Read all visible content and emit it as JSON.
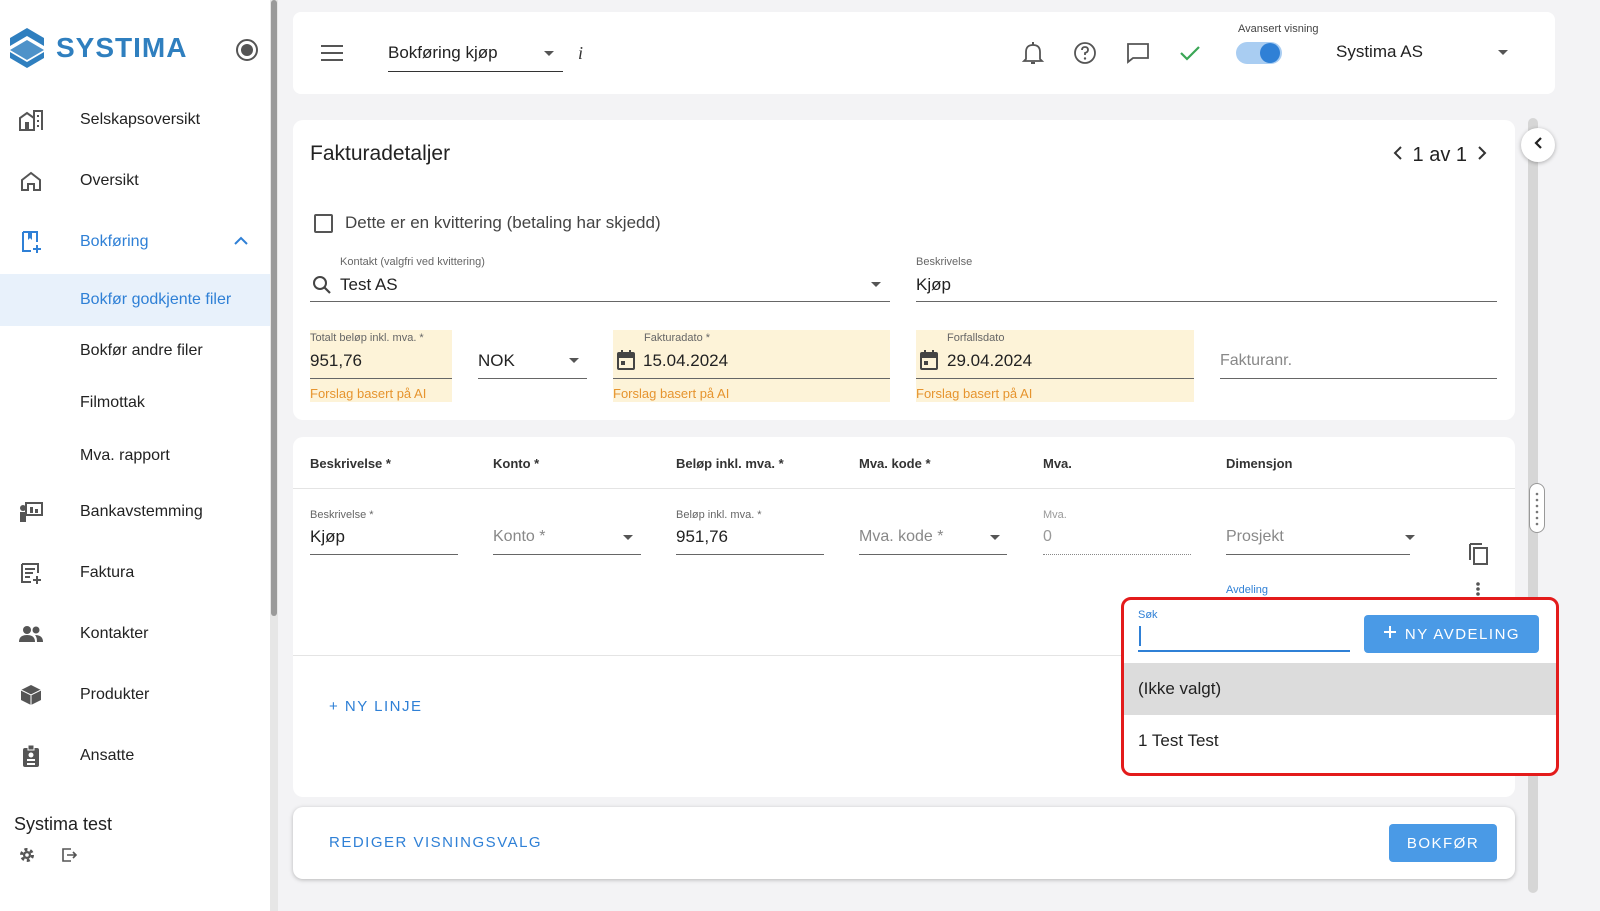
{
  "sidebar": {
    "logo_text": "SYSTIMA",
    "items": [
      {
        "label": "Selskapsoversikt",
        "icon": "company-overview-icon"
      },
      {
        "label": "Oversikt",
        "icon": "home-icon"
      },
      {
        "label": "Bokføring",
        "icon": "bookkeeping-icon"
      },
      {
        "label": "Bokfør godkjente filer"
      },
      {
        "label": "Bokfør andre filer"
      },
      {
        "label": "Filmottak"
      },
      {
        "label": "Mva. rapport"
      },
      {
        "label": "Bankavstemming",
        "icon": "bank-reconciliation-icon"
      },
      {
        "label": "Faktura",
        "icon": "invoice-icon"
      },
      {
        "label": "Kontakter",
        "icon": "contacts-icon"
      },
      {
        "label": "Produkter",
        "icon": "products-icon"
      },
      {
        "label": "Ansatte",
        "icon": "employees-icon"
      }
    ],
    "company_name": "Systima test"
  },
  "topbar": {
    "page_select": "Bokføring kjøp",
    "info": "i",
    "advanced_label": "Avansert visning",
    "advanced_on": true,
    "company": "Systima AS"
  },
  "invoice": {
    "title": "Fakturadetaljer",
    "pager": "1 av 1",
    "receipt_checkbox": "Dette er en kvittering (betaling har skjedd)",
    "contact_label": "Kontakt (valgfri ved kvittering)",
    "contact_value": "Test AS",
    "description_label": "Beskrivelse",
    "description_value": "Kjøp",
    "total_label": "Totalt beløp inkl. mva. *",
    "total_value": "951,76",
    "currency": "NOK",
    "invoice_date_label": "Fakturadato *",
    "invoice_date": "15.04.2024",
    "due_date_label": "Forfallsdato",
    "due_date": "29.04.2024",
    "invoice_no_placeholder": "Fakturanr.",
    "ai_hint": "Forslag basert på AI"
  },
  "lines": {
    "headers": [
      "Beskrivelse *",
      "Konto *",
      "Beløp inkl. mva. *",
      "Mva. kode *",
      "Mva.",
      "Dimensjon"
    ],
    "row": {
      "desc_label": "Beskrivelse *",
      "desc_value": "Kjøp",
      "konto_placeholder": "Konto *",
      "amount_label": "Beløp inkl. mva. *",
      "amount_value": "951,76",
      "vat_code_placeholder": "Mva. kode *",
      "vat_label": "Mva.",
      "vat_value": "0",
      "project_placeholder": "Prosjekt",
      "department_label": "Avdeling"
    },
    "new_line": "+ NY LINJE"
  },
  "bottom": {
    "edit_view": "REDIGER VISNINGSVALG",
    "post": "BOKFØR"
  },
  "popup": {
    "search_label": "Søk",
    "new_dept_button": "NY AVDELING",
    "options": [
      "(Ikke valgt)",
      "1 Test Test"
    ],
    "highlight_color": "#e31b1b"
  }
}
